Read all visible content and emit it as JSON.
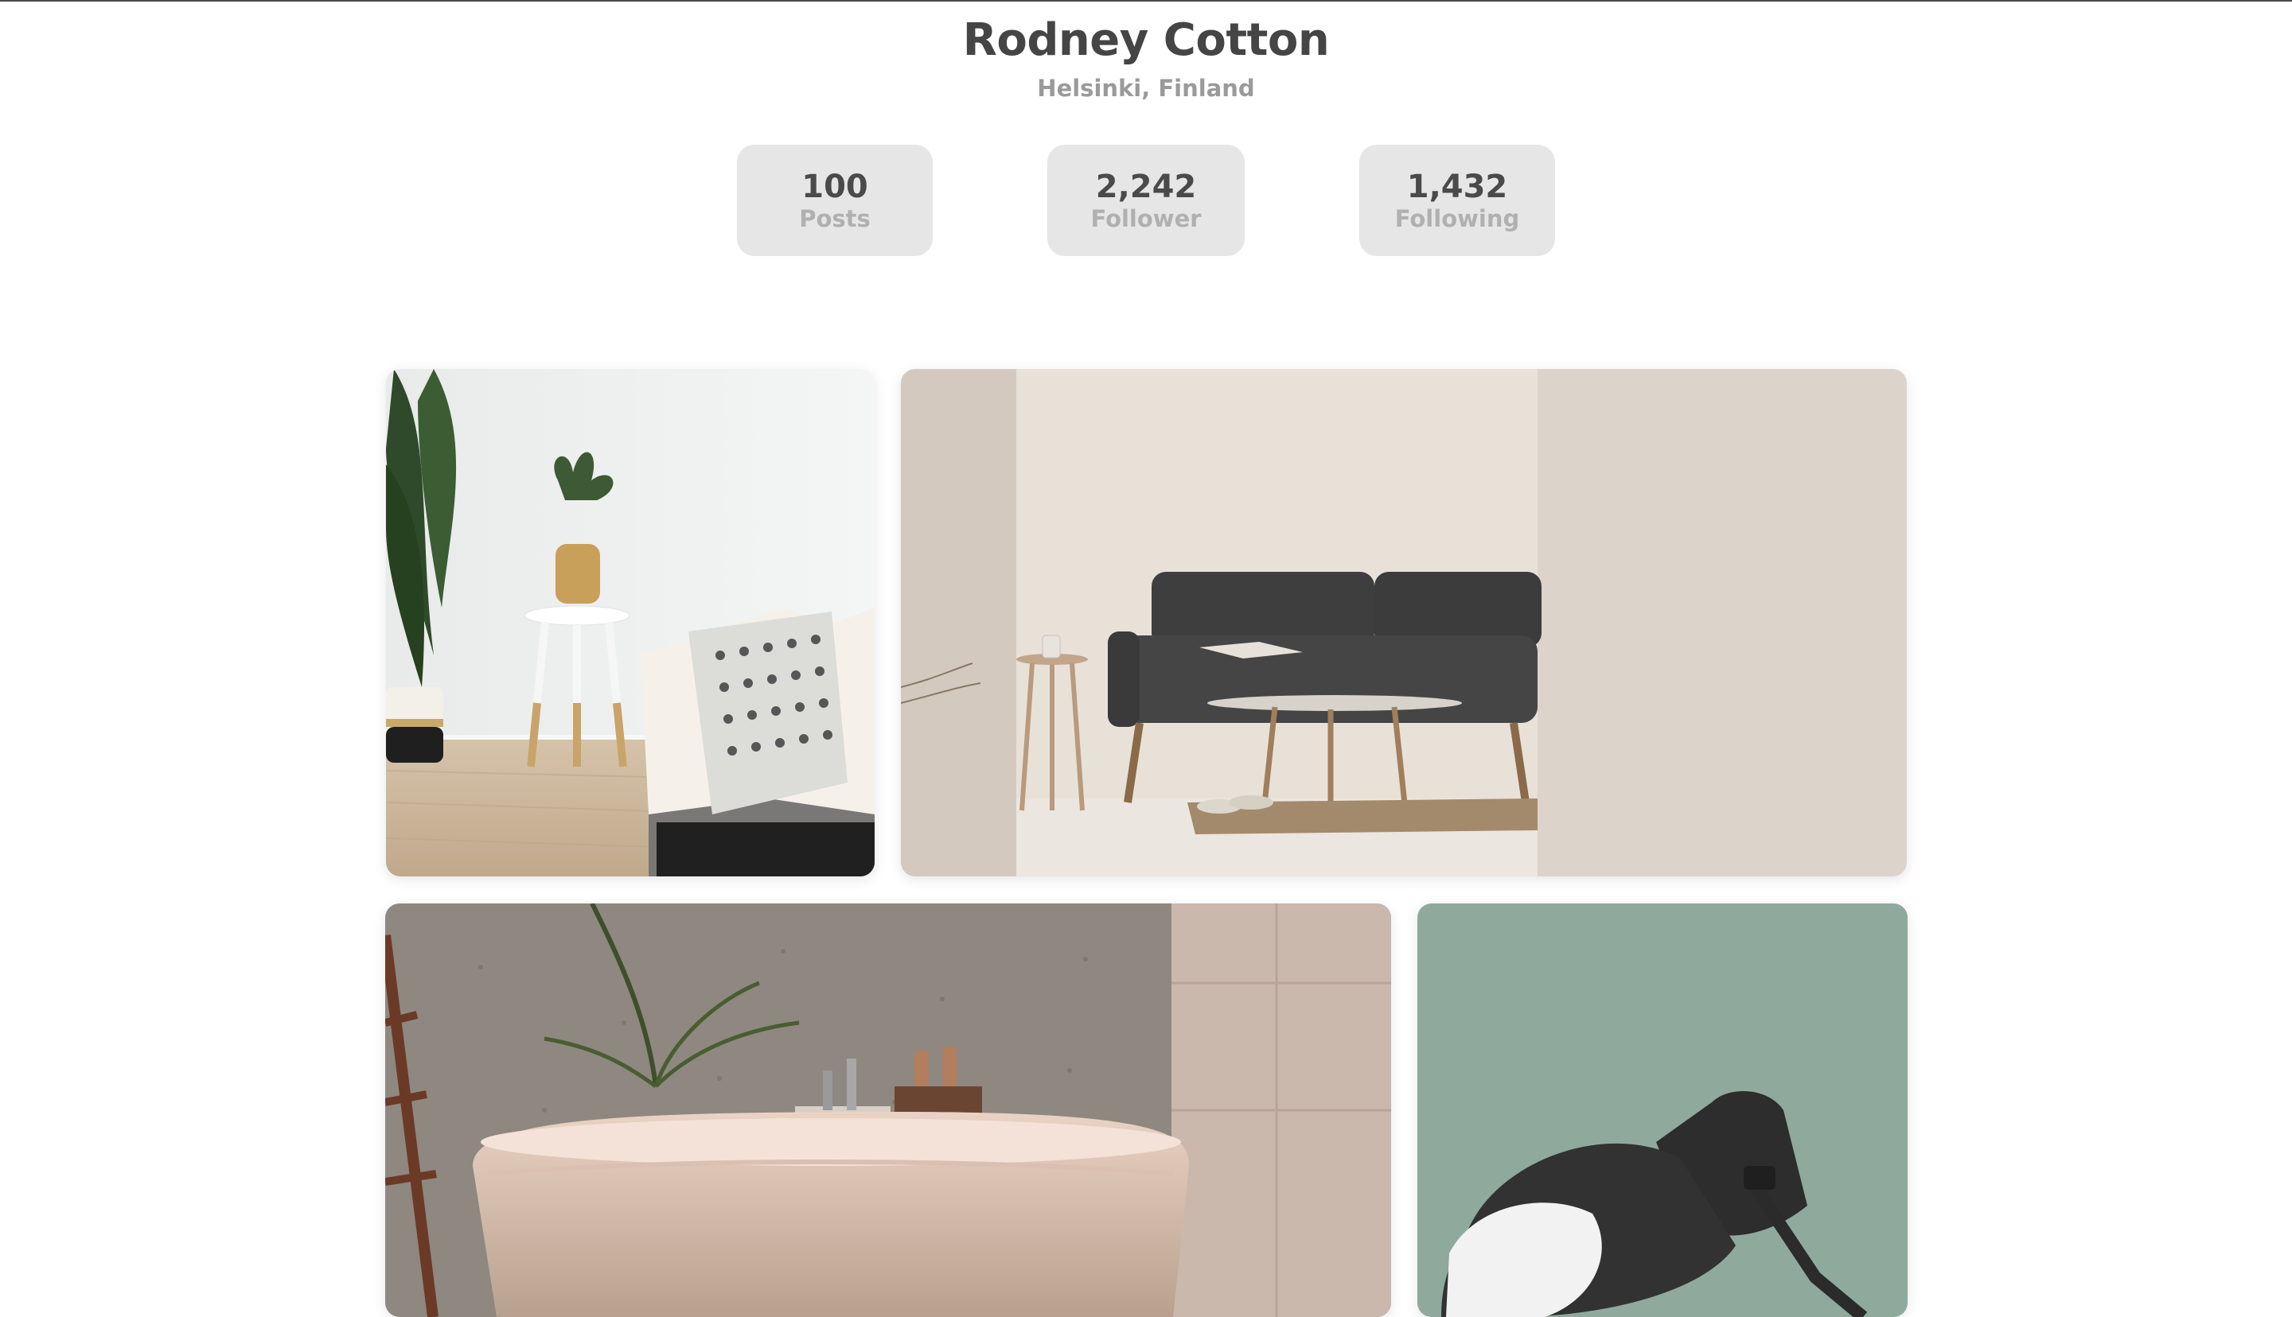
{
  "profile": {
    "name": "Rodney Cotton",
    "location": "Helsinki, Finland"
  },
  "stats": [
    {
      "value": "100",
      "label": "Posts"
    },
    {
      "value": "2,242",
      "label": "Follower"
    },
    {
      "value": "1,432",
      "label": "Following"
    }
  ],
  "gallery": [
    {
      "subject": "living room corner with plant, side table and sofa"
    },
    {
      "subject": "dark grey sofa with coffee table in beige room"
    },
    {
      "subject": "pink freestanding bathtub against textured wall"
    },
    {
      "subject": "black desk lamp against sage green wall"
    }
  ],
  "colors": {
    "title": "#454545",
    "muted": "#9a9a9a",
    "stat_bg": "#e6e6e6"
  }
}
